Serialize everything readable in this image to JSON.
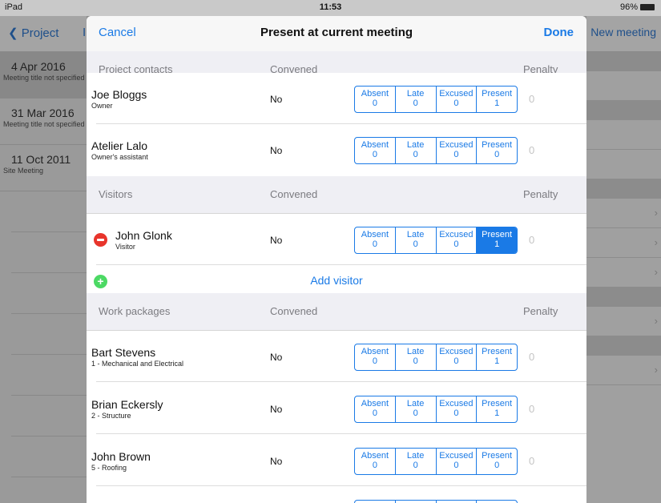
{
  "status_bar": {
    "device": "iPad",
    "time": "11:53",
    "battery": "96%"
  },
  "background": {
    "back_label": "Project",
    "right_action": "New meeting",
    "meetings": [
      {
        "date": "4 Apr 2016",
        "title": "Meeting title not specified"
      },
      {
        "date": "31 Mar 2016",
        "title": "Meeting title not specified"
      },
      {
        "date": "11 Oct 2011",
        "title": "Site Meeting"
      }
    ]
  },
  "modal": {
    "cancel": "Cancel",
    "title": "Present at current meeting",
    "done": "Done",
    "segment_labels": [
      "Absent",
      "Late",
      "Excused",
      "Present"
    ],
    "sections": [
      {
        "header": "Project contacts",
        "convened": "Convened",
        "penalty": "Penalty",
        "rows": [
          {
            "name": "Joe Bloggs",
            "role": "Owner",
            "convened": "No",
            "counts": [
              "0",
              "0",
              "0",
              "1"
            ],
            "penalty": "0"
          },
          {
            "name": "Atelier Lalo",
            "role": "Owner's assistant",
            "convened": "No",
            "counts": [
              "0",
              "0",
              "0",
              "0"
            ],
            "penalty": "0"
          }
        ]
      },
      {
        "header": "Visitors",
        "convened": "Convened",
        "penalty": "Penalty",
        "rows": [
          {
            "name": "John Glonk",
            "role": "Visitor",
            "convened": "No",
            "counts": [
              "0",
              "0",
              "0",
              "1"
            ],
            "penalty": "0",
            "selected": "Present"
          }
        ],
        "add_label": "Add visitor"
      },
      {
        "header": "Work packages",
        "convened": "Convened",
        "penalty": "Penalty",
        "rows": [
          {
            "name": "Bart Stevens",
            "role": "1 - Mechanical and Electrical",
            "convened": "No",
            "counts": [
              "0",
              "0",
              "0",
              "1"
            ],
            "penalty": "0"
          },
          {
            "name": "Brian Eckersly",
            "role": "2 - Structure",
            "convened": "No",
            "counts": [
              "0",
              "0",
              "0",
              "1"
            ],
            "penalty": "0"
          },
          {
            "name": "John Brown",
            "role": "5 - Roofing",
            "convened": "No",
            "counts": [
              "0",
              "0",
              "0",
              "0"
            ],
            "penalty": "0"
          }
        ]
      }
    ]
  },
  "colors": {
    "accent": "#1a7ae6",
    "delete": "#e8352c",
    "add": "#4cd964"
  },
  "icons": {
    "back": "chevron-left-icon",
    "delete": "minus-circle-icon",
    "add": "plus-circle-icon"
  }
}
